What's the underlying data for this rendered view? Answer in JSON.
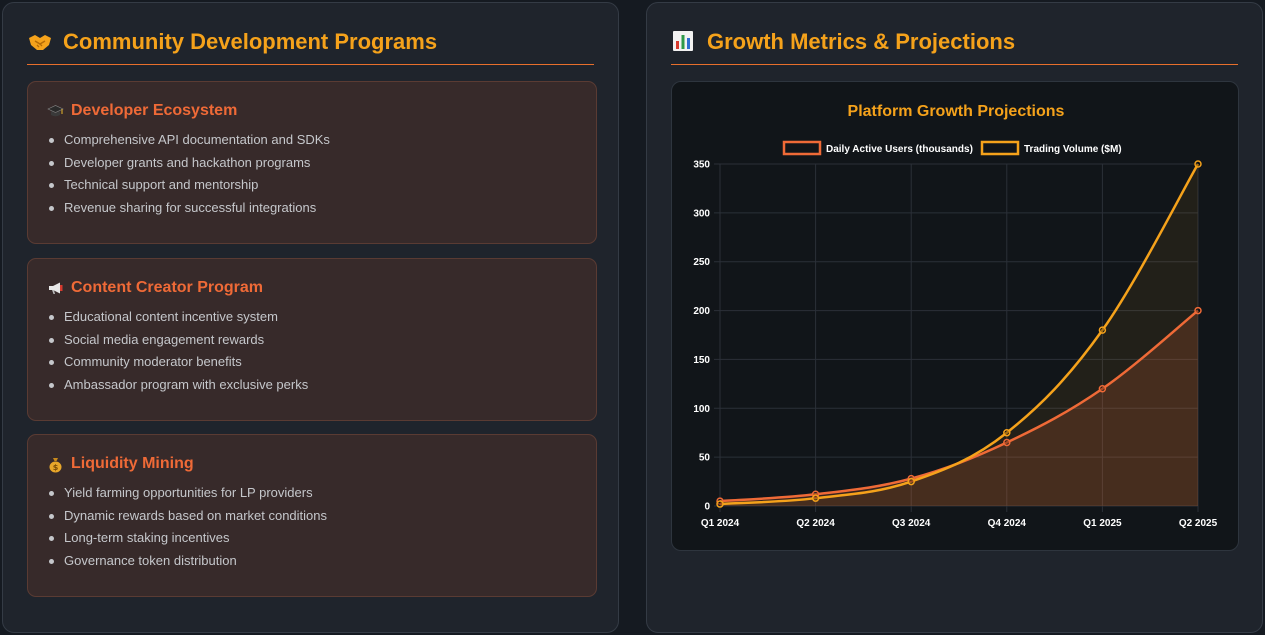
{
  "left_panel": {
    "title": "Community Development Programs",
    "title_icon": "handshake-icon",
    "cards": [
      {
        "title": "Developer Ecosystem",
        "icon": "graduation-cap-icon",
        "items": [
          "Comprehensive API documentation and SDKs",
          "Developer grants and hackathon programs",
          "Technical support and mentorship",
          "Revenue sharing for successful integrations"
        ]
      },
      {
        "title": "Content Creator Program",
        "icon": "megaphone-icon",
        "items": [
          "Educational content incentive system",
          "Social media engagement rewards",
          "Community moderator benefits",
          "Ambassador program with exclusive perks"
        ]
      },
      {
        "title": "Liquidity Mining",
        "icon": "money-bag-icon",
        "items": [
          "Yield farming opportunities for LP providers",
          "Dynamic rewards based on market conditions",
          "Long-term staking incentives",
          "Governance token distribution"
        ]
      }
    ]
  },
  "right_panel": {
    "title": "Growth Metrics & Projections",
    "title_icon": "bar-chart-icon"
  },
  "colors": {
    "accent": "#f5a21b",
    "series_dau": "#ef6a37",
    "series_volume": "#f5a21b"
  },
  "chart_data": {
    "type": "line",
    "title": "Platform Growth Projections",
    "categories": [
      "Q1 2024",
      "Q2 2024",
      "Q3 2024",
      "Q4 2024",
      "Q1 2025",
      "Q2 2025"
    ],
    "series": [
      {
        "name": "Daily Active Users (thousands)",
        "values": [
          5,
          12,
          28,
          65,
          120,
          200
        ],
        "color": "#ef6a37",
        "fill": true
      },
      {
        "name": "Trading Volume ($M)",
        "values": [
          2,
          8,
          25,
          75,
          180,
          350
        ],
        "color": "#f5a21b",
        "fill": true
      }
    ],
    "ylim": [
      0,
      350
    ],
    "yticks": [
      0,
      50,
      100,
      150,
      200,
      250,
      300,
      350
    ],
    "legend": "top",
    "grid": true
  }
}
